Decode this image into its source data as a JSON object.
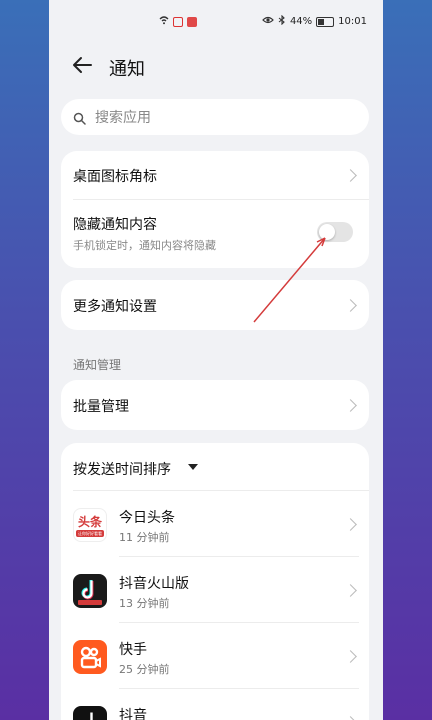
{
  "status_bar": {
    "battery": "44%",
    "time": "10:01"
  },
  "header": {
    "title": "通知"
  },
  "search": {
    "placeholder": "搜索应用"
  },
  "settings": {
    "badge_label": "桌面图标角标",
    "hide_content_label": "隐藏通知内容",
    "hide_content_sub": "手机锁定时，通知内容将隐藏",
    "hide_content_on": false,
    "more_settings_label": "更多通知设置"
  },
  "management": {
    "section_title": "通知管理",
    "batch_label": "批量管理"
  },
  "sort": {
    "label": "按发送时间排序"
  },
  "apps": [
    {
      "name": "今日头条",
      "time": "11 分钟前",
      "icon": "toutiao-icon",
      "icon_text": "头条",
      "icon_sub": "让你好好看看"
    },
    {
      "name": "抖音火山版",
      "time": "13 分钟前",
      "icon": "douyin-huoshan-icon"
    },
    {
      "name": "快手",
      "time": "25 分钟前",
      "icon": "kuaishou-icon"
    },
    {
      "name": "抖音",
      "time": "",
      "icon": "douyin-icon"
    }
  ],
  "colors": {
    "accent_red": "#d43b3b",
    "kuaishou_orange": "#ff5a1f"
  }
}
